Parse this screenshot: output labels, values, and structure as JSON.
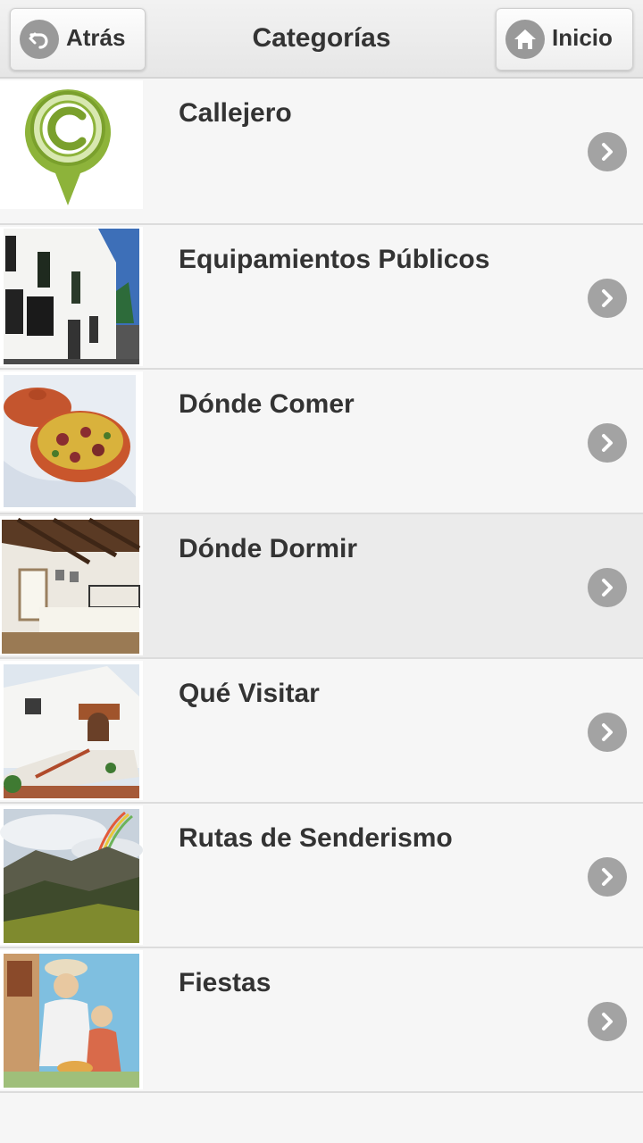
{
  "header": {
    "title": "Categorías",
    "back_label": "Atrás",
    "home_label": "Inicio"
  },
  "categories": [
    {
      "label": "Callejero",
      "thumb_icon": "map-pin-c-logo"
    },
    {
      "label": "Equipamientos Públicos",
      "thumb_icon": "white-building-photo"
    },
    {
      "label": "Dónde Comer",
      "thumb_icon": "clay-pot-stew-photo"
    },
    {
      "label": "Dónde Dormir",
      "thumb_icon": "bedroom-photo"
    },
    {
      "label": "Qué Visitar",
      "thumb_icon": "white-chapel-photo"
    },
    {
      "label": "Rutas de Senderismo",
      "thumb_icon": "mountain-rainbow-photo"
    },
    {
      "label": "Fiestas",
      "thumb_icon": "festival-painting-photo"
    }
  ],
  "colors": {
    "accent_green": "#8db33a",
    "chevron_gray": "#a3a3a3",
    "header_bg": "#ececec"
  }
}
